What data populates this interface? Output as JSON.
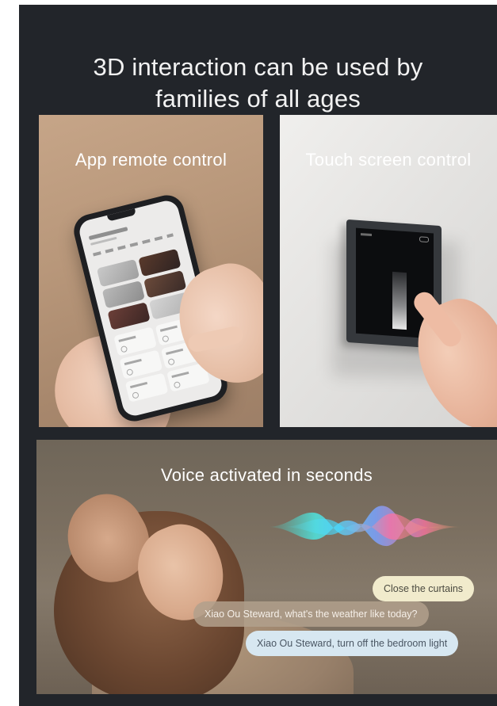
{
  "headline": {
    "line1": "3D interaction can be used by",
    "line2": "families of all ages"
  },
  "panels": {
    "app": {
      "label": "App remote control"
    },
    "touch": {
      "label": "Touch screen control"
    },
    "voice": {
      "label": "Voice activated in seconds",
      "bubbles": [
        "Close the curtains",
        "Xiao Ou Steward, what's the weather like today?",
        "Xiao Ou Steward, turn off the bedroom light"
      ]
    }
  },
  "colors": {
    "background": "#22252a",
    "bubble_yellow": "#f1ebcc",
    "bubble_brown": "#b2a08c",
    "bubble_blue": "#d7e7f1"
  }
}
